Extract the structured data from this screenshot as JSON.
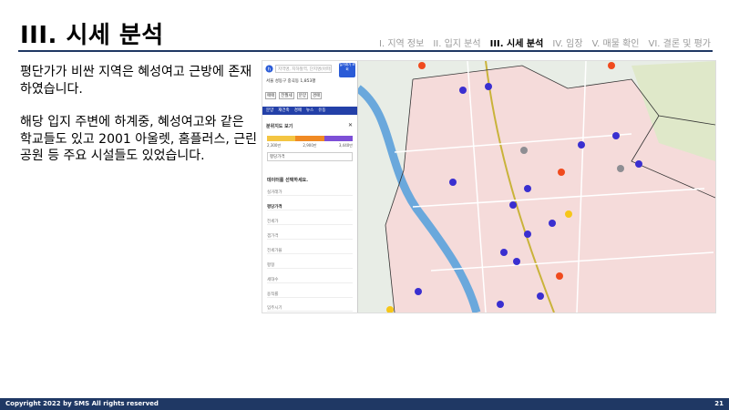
{
  "slide": {
    "title": "III. 시세 분석",
    "nav": [
      "I. 지역 정보",
      "II. 입지 분석",
      "III. 시세 분석",
      "IV. 임장",
      "V. 매물 확인",
      "VI. 결론 및 평가"
    ],
    "nav_active_index": 2,
    "paragraphs": [
      "평단가가 비싼 지역은 혜성여고 근방에 존재하였습니다.",
      "해당 입지 주변에 하계중, 혜성여고와 같은 학교들도 있고 2001 아울렛, 홈플러스, 근린공원 등 주요 시설들도 있었습니다."
    ],
    "footer_copyright": "Copyright 2022 by SMS All rights reserved",
    "page_number": "21"
  },
  "app": {
    "search_placeholder": "지역명, 지하철역, 단지명(아파트명) 검색",
    "badge_text": "실거래가 조회",
    "location_text": "서울 성동구 중곡동",
    "location_count": "1,853평",
    "tabs": [
      "매매",
      "전월세",
      "분양",
      "경매"
    ],
    "blue_tabs": [
      "분양",
      "재건축",
      "경매",
      "뉴스",
      "유동"
    ],
    "dist_title": "분위지도 보기",
    "legend_labels": [
      "2,300만",
      "2,900만",
      "3,440만"
    ],
    "legend_colors": [
      "#f4c542",
      "#f08a24",
      "#7d4fd6"
    ],
    "select_value": "평당가격",
    "section_title": "데이터를 선택하세요.",
    "options": [
      "실거래가",
      "평당가격",
      "전세가",
      "갭가격",
      "전세가율",
      "평형",
      "세대수",
      "용적률",
      "입주시기"
    ],
    "marker_colors": {
      "blue": "#3a2fd0",
      "orange": "#f04a1d",
      "yellow": "#f6c619",
      "gray": "#8e8e93"
    }
  }
}
